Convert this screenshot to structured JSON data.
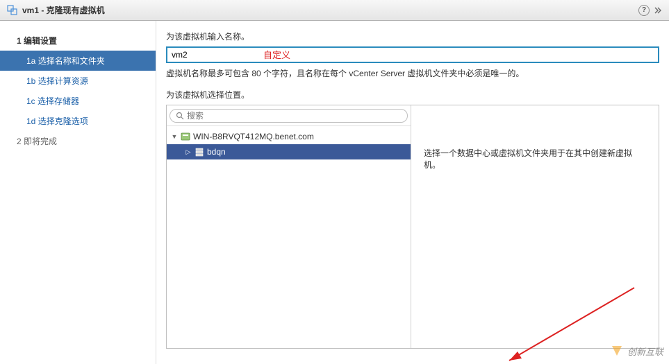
{
  "titlebar": {
    "title": "vm1 - 克隆现有虚拟机",
    "help_symbol": "?"
  },
  "sidebar": {
    "steps": [
      {
        "num": "1",
        "label": "编辑设置"
      },
      {
        "num": "2",
        "label": "即将完成"
      }
    ],
    "substeps": [
      {
        "num": "1a",
        "label": "选择名称和文件夹",
        "active": true
      },
      {
        "num": "1b",
        "label": "选择计算资源",
        "active": false
      },
      {
        "num": "1c",
        "label": "选择存储器",
        "active": false
      },
      {
        "num": "1d",
        "label": "选择克隆选项",
        "active": false
      }
    ]
  },
  "content": {
    "name_label": "为该虚拟机输入名称。",
    "name_value": "vm2",
    "annotation": "自定义",
    "hint": "虚拟机名称最多可包含 80 个字符，且名称在每个 vCenter Server 虚拟机文件夹中必须是唯一的。",
    "location_label": "为该虚拟机选择位置。",
    "search_placeholder": "搜索",
    "tree": {
      "root": "WIN-B8RVQT412MQ.benet.com",
      "child": "bdqn"
    },
    "info_text": "选择一个数据中心或虚拟机文件夹用于在其中创建新虚拟机。"
  },
  "watermark": {
    "text": "创新互联"
  }
}
